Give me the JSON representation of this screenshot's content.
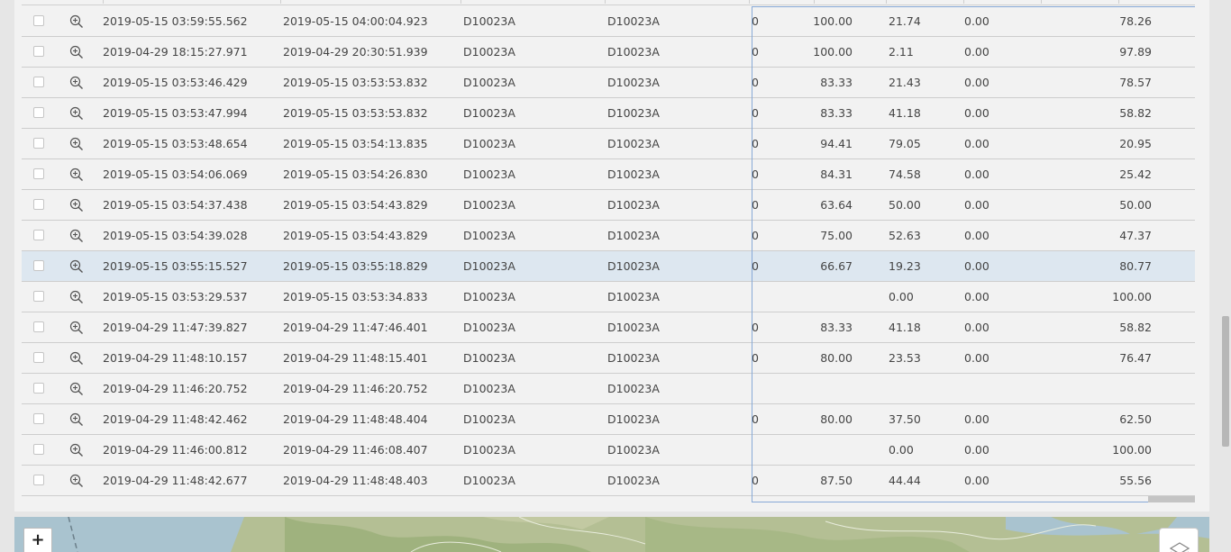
{
  "table": {
    "rows": [
      {
        "start": "2019-05-15 03:59:55.562",
        "end": "2019-05-15 04:00:04.923",
        "id1": "D10023A",
        "id2": "D10023A",
        "c1": "0",
        "c2": "100.00",
        "c3": "21.74",
        "c4": "0.00",
        "c5": "78.26",
        "selected": false
      },
      {
        "start": "2019-04-29 18:15:27.971",
        "end": "2019-04-29 20:30:51.939",
        "id1": "D10023A",
        "id2": "D10023A",
        "c1": "0",
        "c2": "100.00",
        "c3": "2.11",
        "c4": "0.00",
        "c5": "97.89",
        "selected": false
      },
      {
        "start": "2019-05-15 03:53:46.429",
        "end": "2019-05-15 03:53:53.832",
        "id1": "D10023A",
        "id2": "D10023A",
        "c1": "0",
        "c2": "83.33",
        "c3": "21.43",
        "c4": "0.00",
        "c5": "78.57",
        "selected": false
      },
      {
        "start": "2019-05-15 03:53:47.994",
        "end": "2019-05-15 03:53:53.832",
        "id1": "D10023A",
        "id2": "D10023A",
        "c1": "0",
        "c2": "83.33",
        "c3": "41.18",
        "c4": "0.00",
        "c5": "58.82",
        "selected": false
      },
      {
        "start": "2019-05-15 03:53:48.654",
        "end": "2019-05-15 03:54:13.835",
        "id1": "D10023A",
        "id2": "D10023A",
        "c1": "0",
        "c2": "94.41",
        "c3": "79.05",
        "c4": "0.00",
        "c5": "20.95",
        "selected": false
      },
      {
        "start": "2019-05-15 03:54:06.069",
        "end": "2019-05-15 03:54:26.830",
        "id1": "D10023A",
        "id2": "D10023A",
        "c1": "0",
        "c2": "84.31",
        "c3": "74.58",
        "c4": "0.00",
        "c5": "25.42",
        "selected": false
      },
      {
        "start": "2019-05-15 03:54:37.438",
        "end": "2019-05-15 03:54:43.829",
        "id1": "D10023A",
        "id2": "D10023A",
        "c1": "0",
        "c2": "63.64",
        "c3": "50.00",
        "c4": "0.00",
        "c5": "50.00",
        "selected": false
      },
      {
        "start": "2019-05-15 03:54:39.028",
        "end": "2019-05-15 03:54:43.829",
        "id1": "D10023A",
        "id2": "D10023A",
        "c1": "0",
        "c2": "75.00",
        "c3": "52.63",
        "c4": "0.00",
        "c5": "47.37",
        "selected": false
      },
      {
        "start": "2019-05-15 03:55:15.527",
        "end": "2019-05-15 03:55:18.829",
        "id1": "D10023A",
        "id2": "D10023A",
        "c1": "0",
        "c2": "66.67",
        "c3": "19.23",
        "c4": "0.00",
        "c5": "80.77",
        "selected": true
      },
      {
        "start": "2019-05-15 03:53:29.537",
        "end": "2019-05-15 03:53:34.833",
        "id1": "D10023A",
        "id2": "D10023A",
        "c1": "",
        "c2": "",
        "c3": "0.00",
        "c4": "0.00",
        "c5": "100.00",
        "selected": false
      },
      {
        "start": "2019-04-29 11:47:39.827",
        "end": "2019-04-29 11:47:46.401",
        "id1": "D10023A",
        "id2": "D10023A",
        "c1": "0",
        "c2": "83.33",
        "c3": "41.18",
        "c4": "0.00",
        "c5": "58.82",
        "selected": false
      },
      {
        "start": "2019-04-29 11:48:10.157",
        "end": "2019-04-29 11:48:15.401",
        "id1": "D10023A",
        "id2": "D10023A",
        "c1": "0",
        "c2": "80.00",
        "c3": "23.53",
        "c4": "0.00",
        "c5": "76.47",
        "selected": false
      },
      {
        "start": "2019-04-29 11:46:20.752",
        "end": "2019-04-29 11:46:20.752",
        "id1": "D10023A",
        "id2": "D10023A",
        "c1": "",
        "c2": "",
        "c3": "",
        "c4": "",
        "c5": "",
        "selected": false
      },
      {
        "start": "2019-04-29 11:48:42.462",
        "end": "2019-04-29 11:48:48.404",
        "id1": "D10023A",
        "id2": "D10023A",
        "c1": "0",
        "c2": "80.00",
        "c3": "37.50",
        "c4": "0.00",
        "c5": "62.50",
        "selected": false
      },
      {
        "start": "2019-04-29 11:46:00.812",
        "end": "2019-04-29 11:46:08.407",
        "id1": "D10023A",
        "id2": "D10023A",
        "c1": "",
        "c2": "",
        "c3": "0.00",
        "c4": "0.00",
        "c5": "100.00",
        "selected": false
      },
      {
        "start": "2019-04-29 11:48:42.677",
        "end": "2019-04-29 11:48:48.403",
        "id1": "D10023A",
        "id2": "D10023A",
        "c1": "0",
        "c2": "87.50",
        "c3": "44.44",
        "c4": "0.00",
        "c5": "55.56",
        "selected": false
      }
    ]
  },
  "map": {
    "zoom_in_label": "+",
    "layers_icon": "layers-icon"
  },
  "colors": {
    "selected_row": "#dde7f0",
    "selection_border": "#87a9d6",
    "map_water": "#a9c3cf",
    "map_land": "#b4bf94"
  }
}
